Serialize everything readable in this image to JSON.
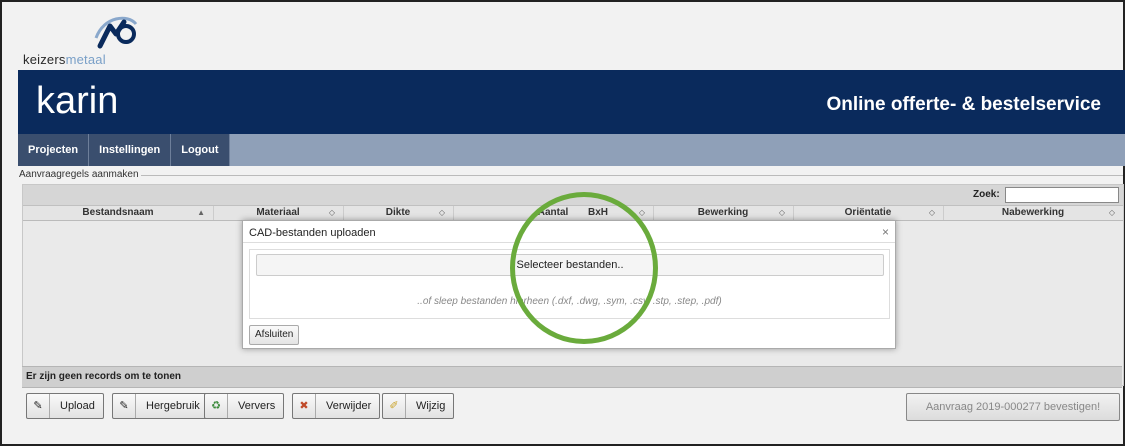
{
  "logo": {
    "text_main": "keizers",
    "text_accent": "metaal"
  },
  "banner": {
    "title": "karin",
    "subtitle": "Online offerte- & bestelservice"
  },
  "nav": {
    "items": [
      "Projecten",
      "Instellingen",
      "Logout"
    ]
  },
  "section": {
    "label": "Aanvraagregels aanmaken"
  },
  "grid": {
    "search_label": "Zoek:",
    "search_value": "",
    "columns": [
      "Bestandsnaam",
      "Materiaal",
      "Dikte",
      "Aantal",
      "BxH",
      "Bewerking",
      "Oriëntatie",
      "Nabewerking"
    ],
    "sort_glyph": "▲",
    "sort_alt_glyph": "◇",
    "empty_message": "Er zijn geen records om te tonen"
  },
  "actions": {
    "upload": "Upload",
    "hergebruik": "Hergebruik",
    "ververs": "Ververs",
    "verwijder": "Verwijder",
    "wijzig": "Wijzig",
    "confirm": "Aanvraag 2019-000277 bevestigen!"
  },
  "modal": {
    "title": "CAD-bestanden uploaden",
    "close_glyph": "×",
    "select_button": "Selecteer bestanden..",
    "drop_hint": "..of sleep bestanden hierheen (.dxf, .dwg, .sym, .csv, .stp, .step, .pdf)",
    "close_button": "Afsluiten"
  },
  "colors": {
    "banner": "#0a2a5c",
    "nav_item": "#3a4e6e",
    "highlight": "#6aab3c"
  }
}
